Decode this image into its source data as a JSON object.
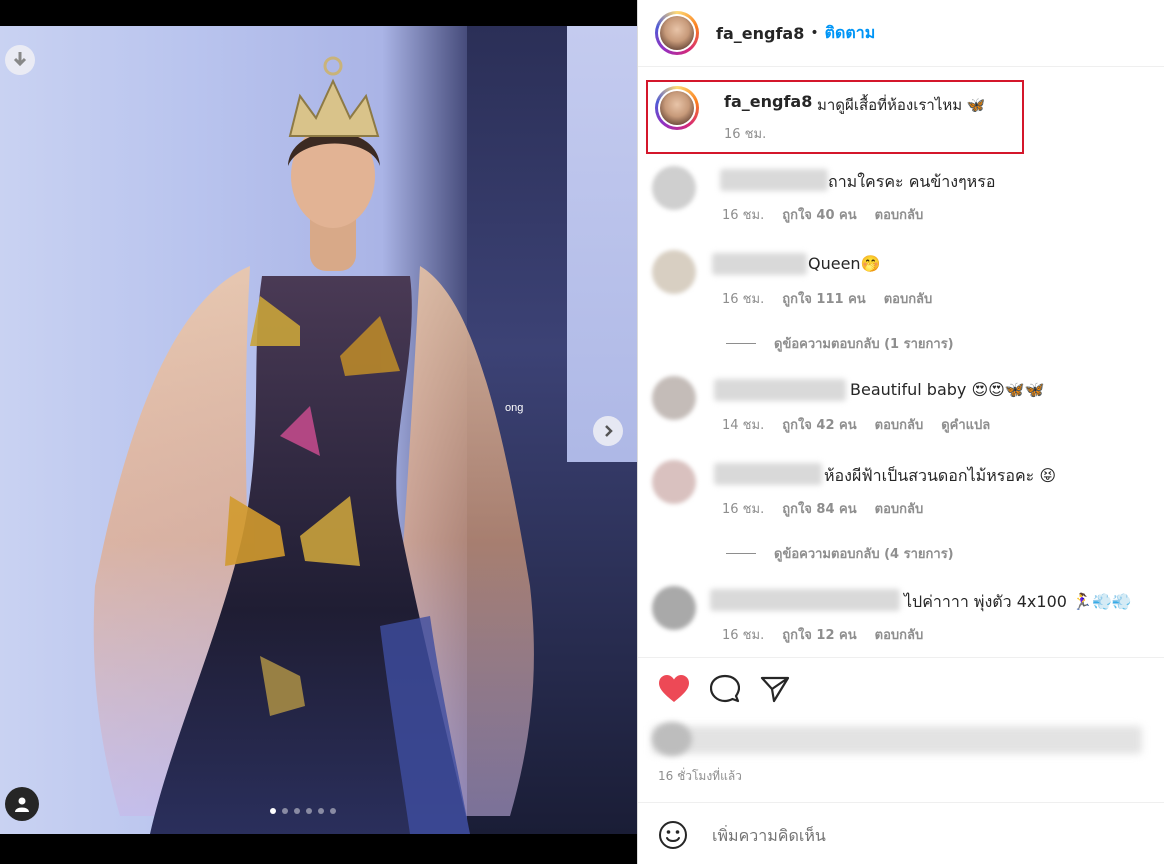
{
  "post": {
    "username": "fa_engfa8",
    "follow_label": "ติดตาม",
    "caption": "มาดูผีเสื้อที่ห้องเราไหม 🦋",
    "caption_time": "16 ชม.",
    "watermark": "ong",
    "carousel_dots": 6,
    "carousel_active": 0
  },
  "comments": [
    {
      "text": "ถามใครคะ คนข้างๆหรอ",
      "time": "16 ชม.",
      "likes": "ถูกใจ 40 คน",
      "reply": "ตอบกลับ",
      "extra": ""
    },
    {
      "text": "Queen🤭",
      "time": "16 ชม.",
      "likes": "ถูกใจ 111 คน",
      "reply": "ตอบกลับ",
      "extra": "",
      "view_replies": "ดูข้อความตอบกลับ (1 รายการ)"
    },
    {
      "text": "Beautiful baby 😍😍🦋🦋",
      "time": "14 ชม.",
      "likes": "ถูกใจ 42 คน",
      "reply": "ตอบกลับ",
      "extra": "ดูคำแปล"
    },
    {
      "text": "ห้องผีฟ้าเป็นสวนดอกไม้หรอคะ 😝",
      "time": "16 ชม.",
      "likes": "ถูกใจ 84 คน",
      "reply": "ตอบกลับ",
      "extra": "",
      "view_replies": "ดูข้อความตอบกลับ (4 รายการ)"
    },
    {
      "text": "ไปค่าาาา พุ่งตัว 4x100 🏃‍♀️💨💨",
      "time": "16 ชม.",
      "likes": "ถูกใจ 12 คน",
      "reply": "ตอบกลับ",
      "extra": ""
    }
  ],
  "footer": {
    "post_time": "16 ชั่วโมงที่แล้ว",
    "comment_placeholder": "เพิ่มความคิดเห็น",
    "liked": true
  },
  "colors": {
    "accent": "#0095f6",
    "highlight_box": "#d4172b",
    "like": "#ed4956"
  }
}
